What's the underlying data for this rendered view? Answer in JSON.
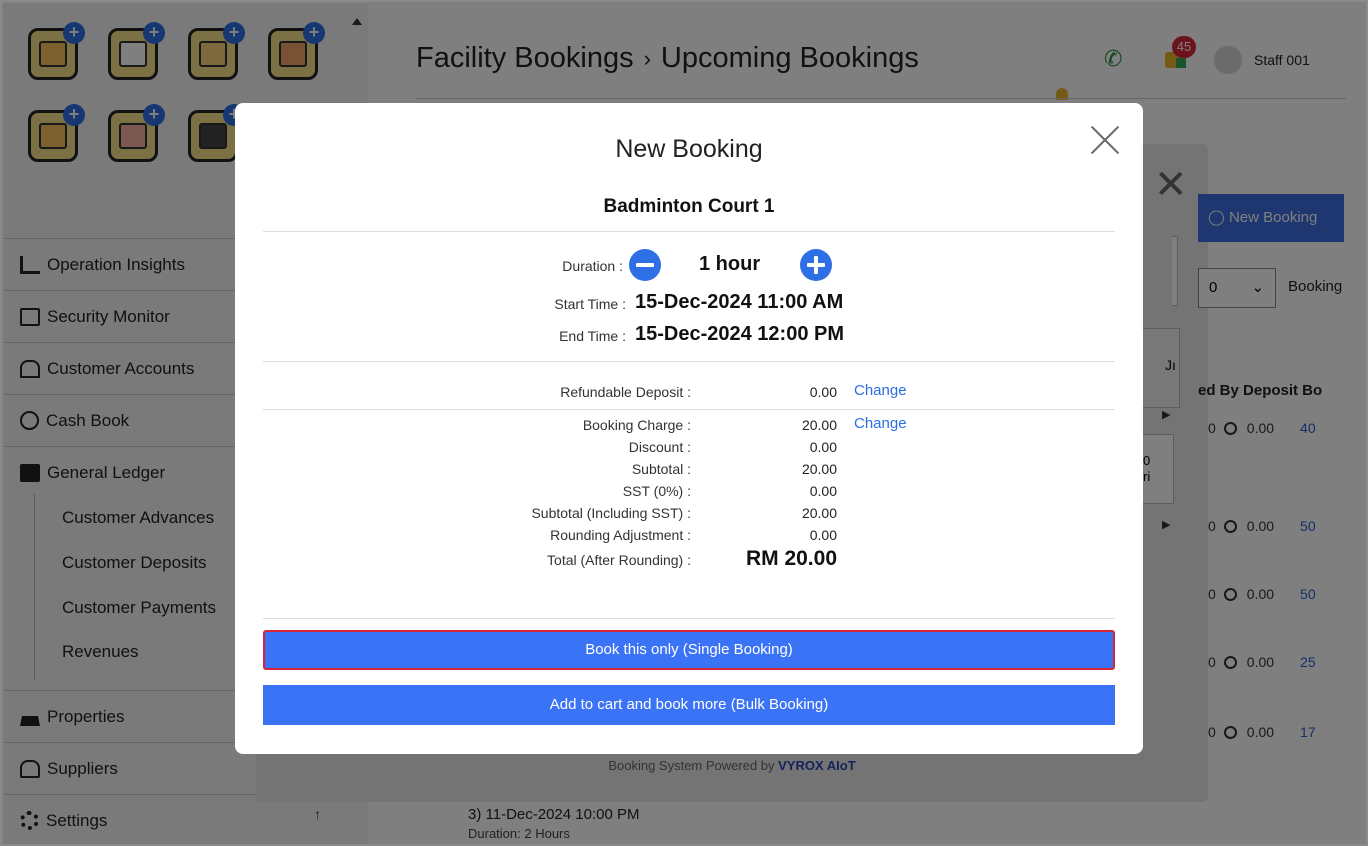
{
  "sidebar": {
    "app_icons": [
      "id-card-icon",
      "calendar-icon",
      "bank-icon",
      "building-icon",
      "key-card-icon",
      "person-icon",
      "card-reader-icon"
    ],
    "nav": [
      {
        "label": "Operation Insights",
        "icon": "bar-chart-icon"
      },
      {
        "label": "Security Monitor",
        "icon": "monitor-icon"
      },
      {
        "label": "Customer Accounts",
        "icon": "home-icon"
      },
      {
        "label": "Cash Book",
        "icon": "dollar-icon"
      },
      {
        "label": "General Ledger",
        "icon": "ledger-icon"
      }
    ],
    "sub_items": [
      "Customer Advances",
      "Customer Deposits",
      "Customer Payments",
      "Revenues"
    ],
    "nav_bottom": [
      {
        "label": "Properties",
        "icon": "house-icon"
      },
      {
        "label": "Suppliers",
        "icon": "supplier-icon"
      },
      {
        "label": "Settings",
        "icon": "gear-icon"
      }
    ],
    "scroll_down": "↑"
  },
  "header": {
    "breadcrumb_root": "Facility Bookings",
    "breadcrumb_sep": "›",
    "breadcrumb_current": "Upcoming Bookings",
    "notification_count": "45",
    "staff_name": "Staff 001"
  },
  "background": {
    "new_booking_label": "New Booking",
    "select_value": "0",
    "booking_label": "Booking",
    "tab_text": "Jı",
    "table_header": "ed By  Deposit  Bo",
    "cell_text_1": "0",
    "cell_text_2": "ri",
    "rows": [
      {
        "by": "0",
        "deposit": "0.00",
        "link": "40"
      },
      {
        "by": "0",
        "deposit": "0.00",
        "link": "50"
      },
      {
        "by": "0",
        "deposit": "0.00",
        "link": "50"
      },
      {
        "by": "0",
        "deposit": "0.00",
        "link": "25"
      },
      {
        "by": "0",
        "deposit": "0.00",
        "link": "17"
      }
    ],
    "powered_prefix": "Booking System Powered by ",
    "powered_brand": "VYROX AIoT",
    "bottom_booking": "3) 11-Dec-2024 10:00 PM",
    "bottom_duration": "Duration: 2 Hours"
  },
  "modal": {
    "title": "New Booking",
    "facility": "Badminton Court 1",
    "duration_label": "Duration :",
    "duration_value": "1 hour",
    "start_label": "Start Time :",
    "start_value": "15-Dec-2024 11:00 AM",
    "end_label": "End Time :",
    "end_value": "15-Dec-2024 12:00 PM",
    "deposit": {
      "label": "Refundable Deposit :",
      "value": "0.00",
      "action": "Change"
    },
    "charges": [
      {
        "label": "Booking Charge :",
        "value": "20.00",
        "action": "Change"
      },
      {
        "label": "Discount :",
        "value": "0.00"
      },
      {
        "label": "Subtotal :",
        "value": "20.00"
      },
      {
        "label": "SST (0%) :",
        "value": "0.00"
      },
      {
        "label": "Subtotal (Including SST) :",
        "value": "20.00"
      },
      {
        "label": "Rounding Adjustment :",
        "value": "0.00"
      }
    ],
    "total_label": "Total (After Rounding) :",
    "total_value": "RM 20.00",
    "single_button": "Book this only (Single Booking)",
    "bulk_button": "Add to cart and book more (Bulk Booking)"
  }
}
